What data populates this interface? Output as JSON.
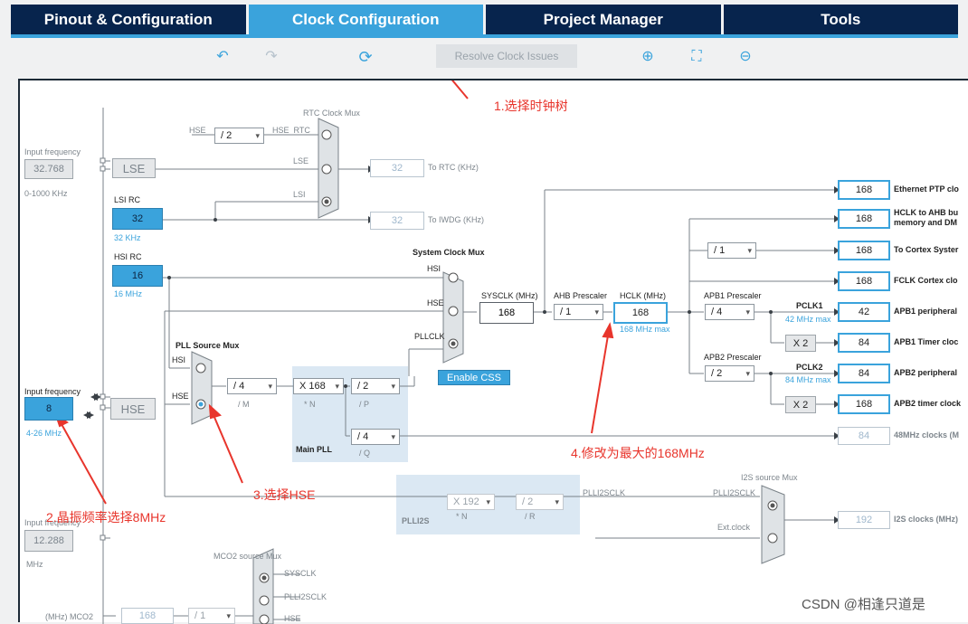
{
  "tabs": [
    "Pinout & Configuration",
    "Clock Configuration",
    "Project Manager",
    "Tools"
  ],
  "toolbar": {
    "resolve": "Resolve Clock Issues"
  },
  "inputs": {
    "lse_label": "Input frequency",
    "lse_value": "32.768",
    "lse_range": "0-1000 KHz",
    "hse_label": "Input frequency",
    "hse_value": "8",
    "hse_range": "4-26 MHz",
    "i2s_label": "Input frequency",
    "i2s_value": "12.288",
    "i2s_unit": "MHz"
  },
  "sources": {
    "lse": "LSE",
    "lsi": "LSI RC",
    "lsi_value": "32",
    "lsi_unit": "32 KHz",
    "hsi": "HSI RC",
    "hsi_value": "16",
    "hsi_unit": "16 MHz",
    "hse": "HSE"
  },
  "rtc": {
    "title": "RTC Clock Mux",
    "hse_div": "/ 2",
    "hse": "HSE",
    "hse_rtc": "HSE_RTC",
    "lse": "LSE",
    "lsi": "LSI",
    "rtc_value": "32",
    "rtc_label": "To RTC (KHz)",
    "iwdg_value": "32",
    "iwdg_label": "To IWDG (KHz)"
  },
  "pll": {
    "mux_title": "PLL Source Mux",
    "hsi": "HSI",
    "hse": "HSE",
    "m": "/ 4",
    "m_label": "/ M",
    "n": "X 168",
    "n_label": "* N",
    "p": "/ 2",
    "p_label": "/ P",
    "q": "/ 4",
    "q_label": "/ Q",
    "main": "Main PLL"
  },
  "sys": {
    "mux_title": "System Clock Mux",
    "hsi": "HSI",
    "hse": "HSE",
    "pllclk": "PLLCLK",
    "css": "Enable CSS",
    "sysclk_label": "SYSCLK (MHz)",
    "sysclk": "168",
    "ahb_label": "AHB Prescaler",
    "ahb": "/ 1",
    "hclk_label": "HCLK (MHz)",
    "hclk": "168",
    "hclk_max": "168 MHz max"
  },
  "apb": {
    "apb1_label": "APB1 Prescaler",
    "apb1": "/ 4",
    "pclk1": "PCLK1",
    "pclk1_max": "42 MHz max",
    "apb2_label": "APB2 Prescaler",
    "apb2": "/ 2",
    "pclk2": "PCLK2",
    "pclk2_max": "84 MHz max",
    "x2": "X 2",
    "cortex_div": "/ 1"
  },
  "outputs": [
    {
      "v": "168",
      "l": "Ethernet PTP clo"
    },
    {
      "v": "168",
      "l": "HCLK to AHB bu"
    },
    {
      "v": "168",
      "l": "To Cortex Syster"
    },
    {
      "v": "168",
      "l": "FCLK Cortex clo"
    },
    {
      "v": "42",
      "l": "APB1 peripheral"
    },
    {
      "v": "84",
      "l": "APB1 Timer cloc"
    },
    {
      "v": "84",
      "l": "APB2 peripheral"
    },
    {
      "v": "168",
      "l": "APB2 timer clock"
    },
    {
      "v": "84",
      "l": "48MHz clocks (M"
    },
    {
      "v": "192",
      "l": "I2S clocks (MHz)"
    }
  ],
  "hclk_sub": "memory and DM",
  "plli2s": {
    "n": "X 192",
    "n_label": "* N",
    "r": "/ 2",
    "r_label": "/ R",
    "name": "PLLI2S",
    "clk": "PLLI2SCLK",
    "i2s_mux": "I2S source Mux",
    "mux_in1": "PLLI2SCLK",
    "mux_in2": "Ext.clock"
  },
  "mco2": {
    "title": "MCO2 source Mux",
    "sysclk": "SYSCLK",
    "plli2s": "PLLI2SCLK",
    "hse": "HSE",
    "value": "168",
    "div": "/ 1",
    "label": "(MHz) MCO2"
  },
  "annotations": {
    "a1": "1.选择时钟树",
    "a2": "2.晶振频率选择8MHz",
    "a3": "3.选择HSE",
    "a4": "4.修改为最大的168MHz"
  },
  "watermark": "CSDN @相逢只道是",
  "colors": {
    "accent": "#3aa3dc",
    "nav": "#07244d",
    "annotation": "#e8352c"
  }
}
